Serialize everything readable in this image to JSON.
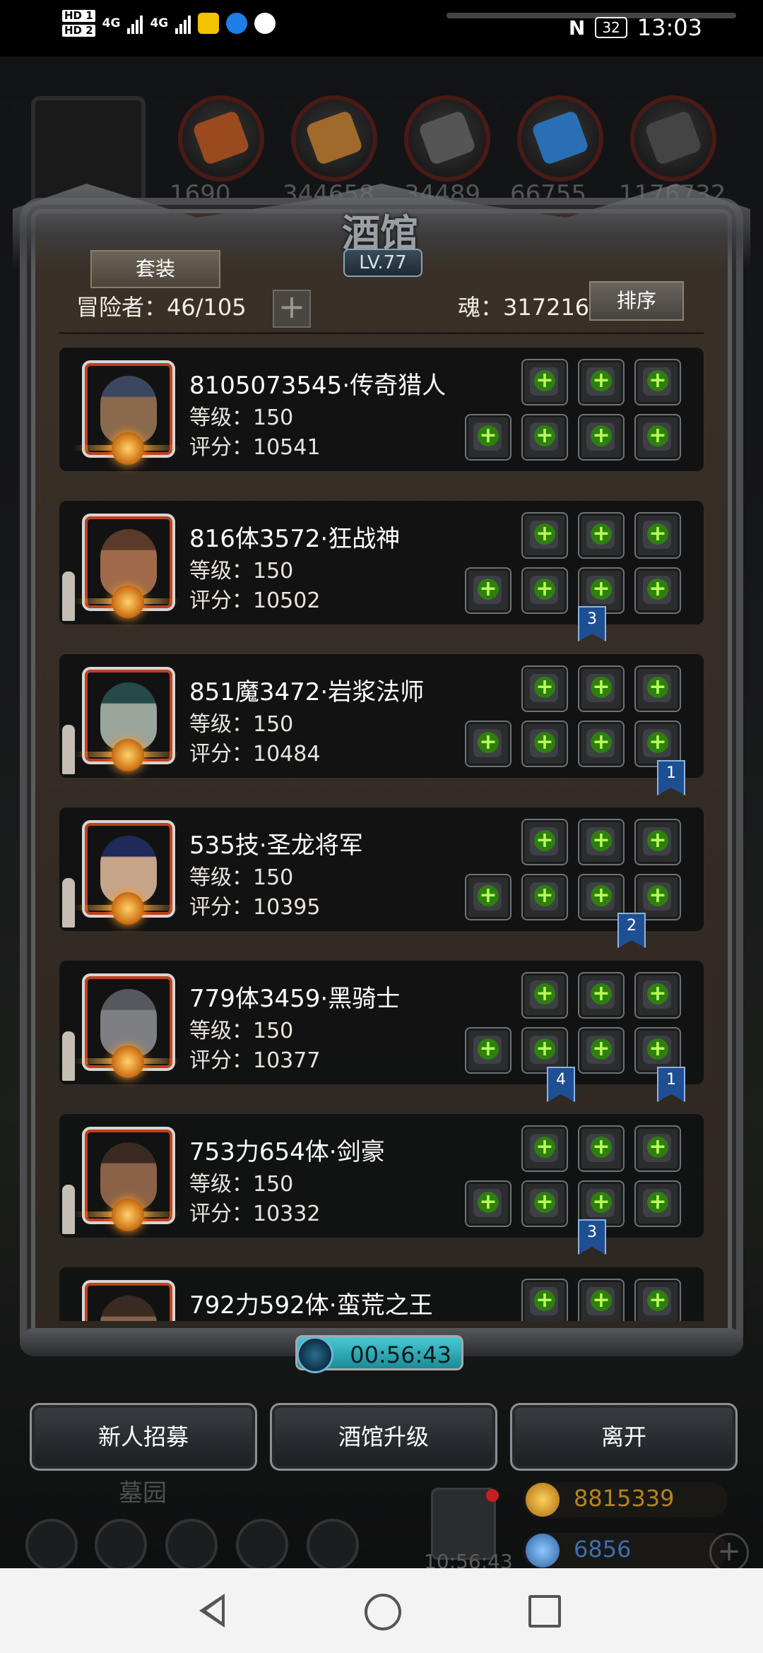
{
  "status_bar": {
    "hd1": "HD 1",
    "hd2": "HD 2",
    "net1": "4G",
    "net2": "4G",
    "battery": "32",
    "time": "13:03"
  },
  "background": {
    "resource_counts": [
      "1690",
      "344658",
      "34489",
      "66755",
      "1176732"
    ]
  },
  "tavern": {
    "title": "酒馆",
    "level": "LV.77",
    "set_button": "套装",
    "adventurers": "冒险者：46/105",
    "soul": "魂：317216",
    "sort_button": "排序",
    "heroes": [
      {
        "name": "8105073545·传奇猎人",
        "level": "等级：150",
        "score": "评分：10541",
        "face": "#8a6a4d",
        "hat": "#3b4660"
      },
      {
        "name": "816体3572·狂战神",
        "level": "等级：150",
        "score": "评分：10502",
        "face": "#a06a4a",
        "hat": "#5a3a28"
      },
      {
        "name": "851魔3472·岩浆法师",
        "level": "等级：150",
        "score": "评分：10484",
        "face": "#9aa59b",
        "hat": "#254a48"
      },
      {
        "name": "535技·圣龙将军",
        "level": "等级：150",
        "score": "评分：10395",
        "face": "#c6a48a",
        "hat": "#1d2a5a"
      },
      {
        "name": "779体3459·黑骑士",
        "level": "等级：150",
        "score": "评分：10377",
        "face": "#7d7f82",
        "hat": "#55585c"
      },
      {
        "name": "753力654体·剑豪",
        "level": "等级：150",
        "score": "评分：10332",
        "face": "#8a6248",
        "hat": "#3a2a22"
      },
      {
        "name": "792力592体·蛮荒之王",
        "level": "",
        "score": "",
        "face": "#8a6248",
        "hat": "#3a2a22"
      }
    ],
    "ribbons": [
      "3",
      "1",
      "2",
      "4",
      "1",
      "3"
    ],
    "timer": "00:56:43"
  },
  "actions": {
    "recruit": "新人招募",
    "upgrade": "酒馆升级",
    "leave": "离开"
  },
  "hud": {
    "location": "墓园",
    "time": "10:56:43",
    "gold": "8815339",
    "gems": "6856"
  },
  "colors": {
    "plus_green": "#2f7f10",
    "timer_cyan": "#49c9d4",
    "ribbon_blue": "#1f4f93",
    "gold_text": "#b5841f",
    "gem_text": "#3b6fb0"
  }
}
